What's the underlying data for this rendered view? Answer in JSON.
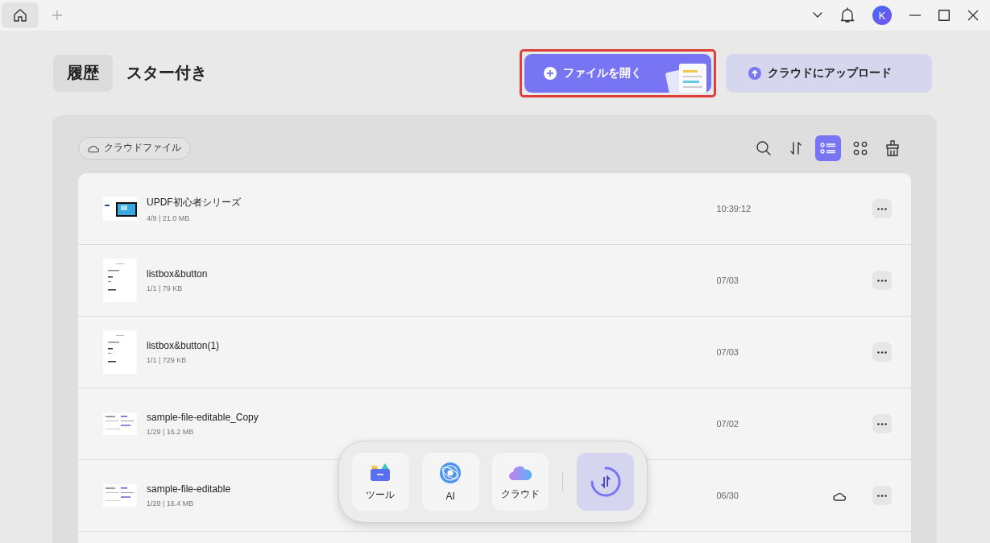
{
  "tabs": [
    {
      "label": "履歴",
      "selected": true
    },
    {
      "label": "スター付き",
      "selected": false
    }
  ],
  "actions": [
    {
      "kind": "primary",
      "label": "ファイルを開く",
      "highlighted": true
    },
    {
      "kind": "secondary",
      "label": "クラウドにアップロード",
      "highlighted": false
    }
  ],
  "cloud_filter": {
    "label": "クラウドファイル"
  },
  "view_modes": [
    {
      "kind": "list",
      "selected": true
    },
    {
      "kind": "grid",
      "selected": false
    }
  ],
  "files": [
    {
      "name": "UPDF初心者シリーズ",
      "meta": "4/9 | 21.0 MB",
      "time": "10:39:12",
      "in_cloud": false
    },
    {
      "name": "listbox&button",
      "meta": "1/1 | 79 KB",
      "time": "07/03",
      "in_cloud": false
    },
    {
      "name": "listbox&button(1)",
      "meta": "1/1 | 729 KB",
      "time": "07/03",
      "in_cloud": false
    },
    {
      "name": "sample-file-editable_Copy",
      "meta": "1/29 | 16.2 MB",
      "time": "07/02",
      "in_cloud": false
    },
    {
      "name": "sample-file-editable",
      "meta": "1/29 | 16.4 MB",
      "time": "06/30",
      "in_cloud": true
    }
  ],
  "dock": [
    {
      "kind": "tools",
      "label": "ツール"
    },
    {
      "kind": "ai",
      "label": "AI"
    },
    {
      "kind": "cloud",
      "label": "クラウド"
    }
  ],
  "user": {
    "initial": "K"
  }
}
